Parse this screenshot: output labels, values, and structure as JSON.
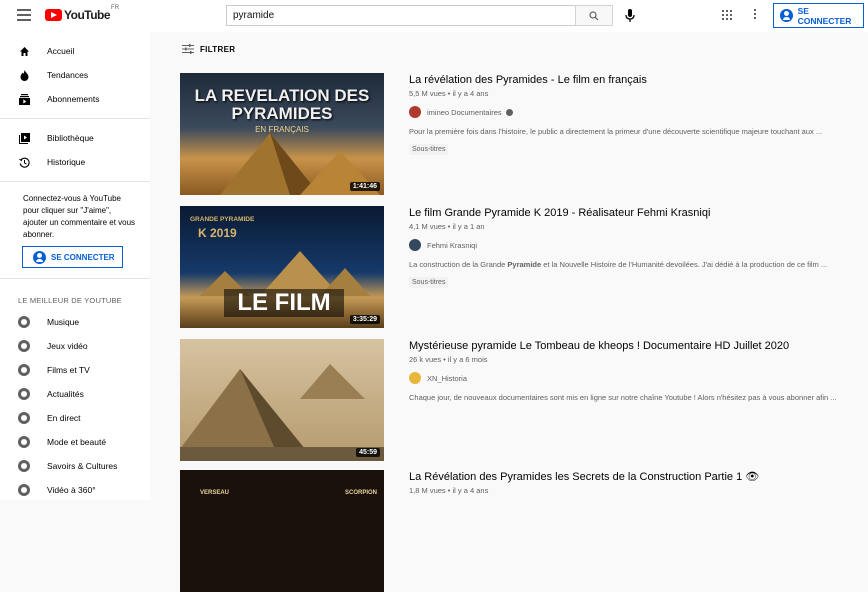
{
  "header": {
    "logo_text": "YouTube",
    "logo_country": "FR",
    "search_value": "pyramide",
    "signin_label": "SE CONNECTER"
  },
  "sidebar": {
    "main_items": [
      {
        "label": "Accueil",
        "icon": "home-icon"
      },
      {
        "label": "Tendances",
        "icon": "flame-icon"
      },
      {
        "label": "Abonnements",
        "icon": "subscriptions-icon"
      }
    ],
    "library_items": [
      {
        "label": "Bibliothèque",
        "icon": "library-icon"
      },
      {
        "label": "Historique",
        "icon": "history-icon"
      }
    ],
    "promo_text": "Connectez-vous à YouTube pour cliquer sur \"J'aime\", ajouter un commentaire et vous abonner.",
    "signin_label": "SE CONNECTER",
    "best_of_title": "LE MEILLEUR DE YOUTUBE",
    "best_of_items": [
      {
        "label": "Musique",
        "icon": "music-icon"
      },
      {
        "label": "Jeux vidéo",
        "icon": "gaming-icon"
      },
      {
        "label": "Films et TV",
        "icon": "movies-icon"
      },
      {
        "label": "Actualités",
        "icon": "news-icon"
      },
      {
        "label": "En direct",
        "icon": "live-icon"
      },
      {
        "label": "Mode et beauté",
        "icon": "fashion-icon"
      },
      {
        "label": "Savoirs & Cultures",
        "icon": "learning-icon"
      },
      {
        "label": "Vidéo à 360°",
        "icon": "360-video-icon"
      }
    ]
  },
  "filter_label": "FILTRER",
  "results": [
    {
      "title": "La révélation des Pyramides - Le film en français",
      "meta": "5,5 M vues • il y a 4 ans",
      "channel": "imineo Documentaires",
      "verified": true,
      "description": "Pour la première fois dans l'histoire, le public a directement la primeur d'une découverte scientifique majeure touchant aux ...",
      "badge": "Sous-titres",
      "duration": "1:41:46",
      "thumb_text": "LA REVELATION DES PYRAMIDES",
      "thumb_sub": "EN FRANÇAIS",
      "avatar_color": "#c0392b"
    },
    {
      "title": "Le film Grande Pyramide K 2019 - Réalisateur Fehmi Krasniqi",
      "meta": "4,1 M vues • il y a 1 an",
      "channel": "Fehmi Krasniqi",
      "verified": false,
      "description_pre": "La construction de la Grande ",
      "description_bold": "Pyramide",
      "description_post": " et la Nouvelle Histoire de l'Humanité devoilées. J'ai dédié à la production de ce film ...",
      "badge": "Sous-titres",
      "duration": "3:35:29",
      "thumb_text": "LE FILM",
      "thumb_brand": "GRANDE PYRAMIDE",
      "thumb_k": "K 2019",
      "avatar_color": "#2c3e50"
    },
    {
      "title": "Mystérieuse pyramide Le Tombeau de kheops ! Documentaire HD Juillet 2020",
      "meta": "26 k vues • il y a 6 mois",
      "channel": "XN_Historia",
      "verified": false,
      "description": "Chaque jour, de nouveaux documentaires sont mis en ligne sur notre chaîne Youtube ! Alors n'hésitez pas à vous abonner afin ...",
      "duration": "45:59",
      "avatar_color": "#d4a017"
    },
    {
      "title": "La Révélation des Pyramides les Secrets de la Construction Partie 1 👁",
      "meta": "1,8 M vues • il y a 4 ans",
      "thumb_left": "VERSEAU",
      "thumb_right": "SCORPION"
    }
  ]
}
